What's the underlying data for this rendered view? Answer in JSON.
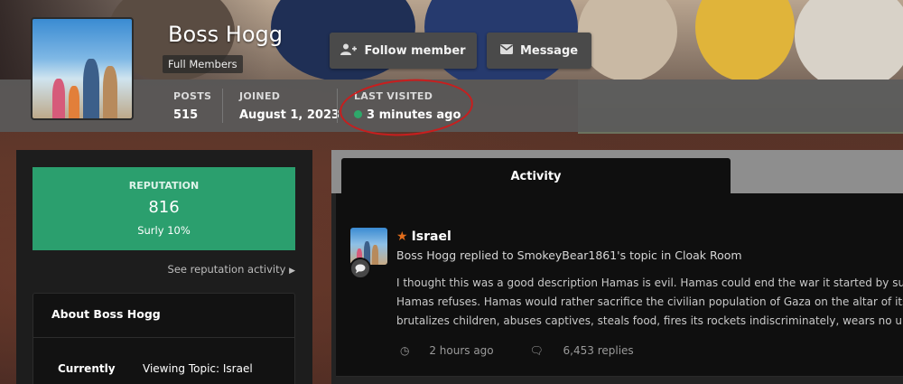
{
  "profile": {
    "name": "Boss Hogg",
    "group": "Full Members",
    "buttons": {
      "follow": "Follow member",
      "message": "Message"
    },
    "stats": {
      "posts_label": "POSTS",
      "posts_value": "515",
      "joined_label": "JOINED",
      "joined_value": "August 1, 2023",
      "last_visited_label": "LAST VISITED",
      "last_visited_value": "3 minutes ago"
    }
  },
  "sidebar": {
    "reputation": {
      "label": "REPUTATION",
      "value": "816",
      "rank": "Surly 10%"
    },
    "see_reputation": "See reputation activity",
    "about": {
      "title": "About Boss Hogg",
      "currently_label": "Currently",
      "currently_value": "Viewing Topic: Israel"
    }
  },
  "main": {
    "tab_label": "Activity",
    "activity_item": {
      "title": "Israel",
      "meta": "Boss Hogg replied to SmokeyBear1861's topic in Cloak Room",
      "body_lines": [
        "I thought this was a good description Hamas is evil. Hamas could end the war it started by surrendering",
        "Hamas refuses. Hamas would rather sacrifice the civilian population of Gaza on the altar of its genocidal",
        "brutalizes children, abuses captives, steals food, fires its rockets indiscriminately, wears no uniforms, and"
      ],
      "time": "2 hours ago",
      "replies": "6,453 replies"
    }
  },
  "icons": {
    "follow": "add-user-icon",
    "message": "envelope-icon",
    "star": "star-icon",
    "clock": "clock-icon",
    "comment": "comment-icon"
  },
  "colors": {
    "reputation_bg": "#2b9f6e",
    "online": "#2ea86a",
    "star": "#e36d1b",
    "annotation": "#c81e1e"
  }
}
